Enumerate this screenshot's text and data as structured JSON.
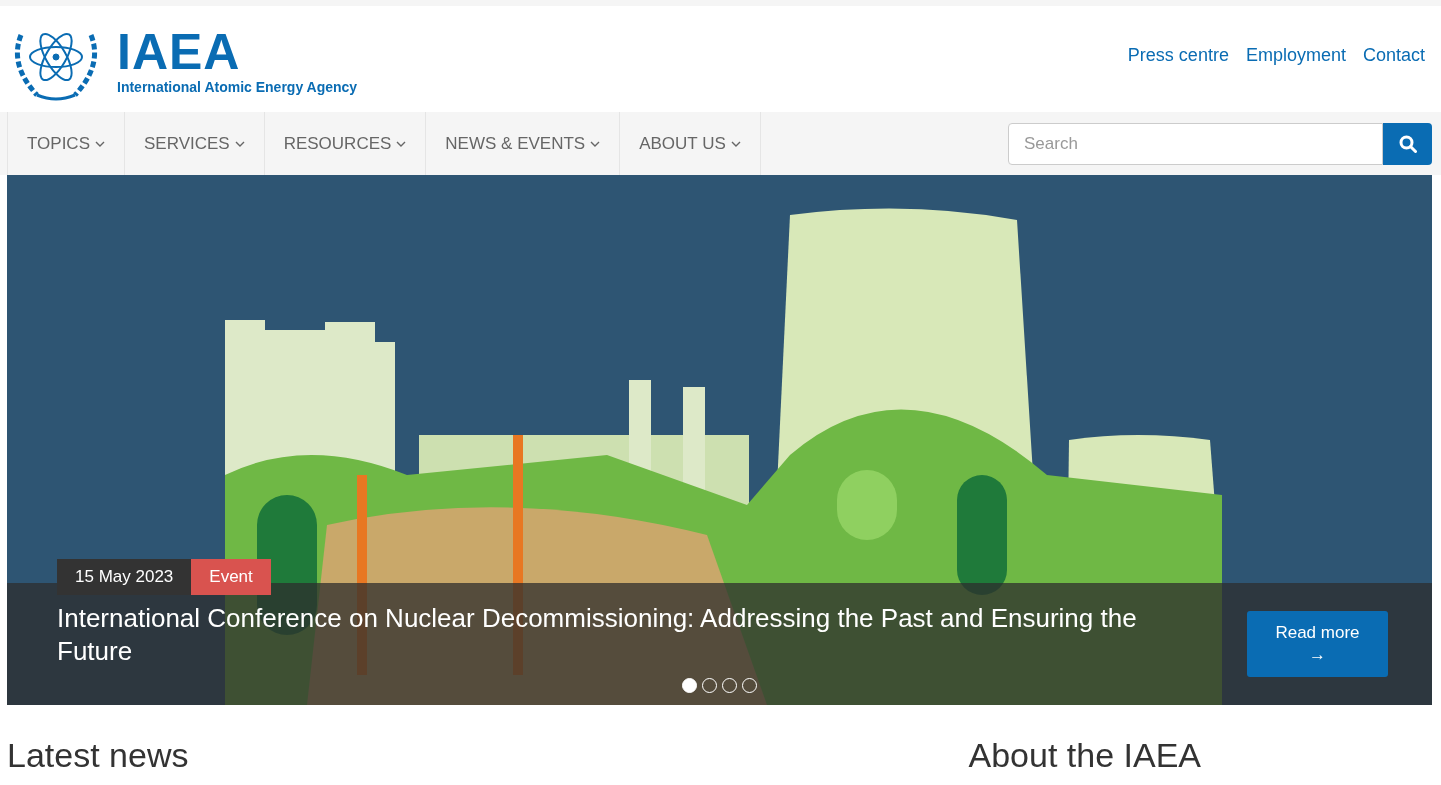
{
  "logo": {
    "acronym": "IAEA",
    "name": "International Atomic Energy Agency"
  },
  "top_links": [
    "Press centre",
    "Employment",
    "Contact"
  ],
  "nav": [
    {
      "label": "TOPICS"
    },
    {
      "label": "SERVICES"
    },
    {
      "label": "RESOURCES"
    },
    {
      "label": "NEWS & EVENTS"
    },
    {
      "label": "ABOUT US"
    }
  ],
  "search": {
    "placeholder": "Search"
  },
  "hero": {
    "date": "15 May 2023",
    "tag": "Event",
    "title": "International Conference on Nuclear Decommissioning: Addressing the Past and Ensuring the Future",
    "button": "Read more",
    "button_arrow": "→",
    "slides": [
      {
        "selected": true
      },
      {
        "selected": false
      },
      {
        "selected": false
      },
      {
        "selected": false
      }
    ]
  },
  "sections": [
    "Latest news",
    "About the IAEA"
  ]
}
